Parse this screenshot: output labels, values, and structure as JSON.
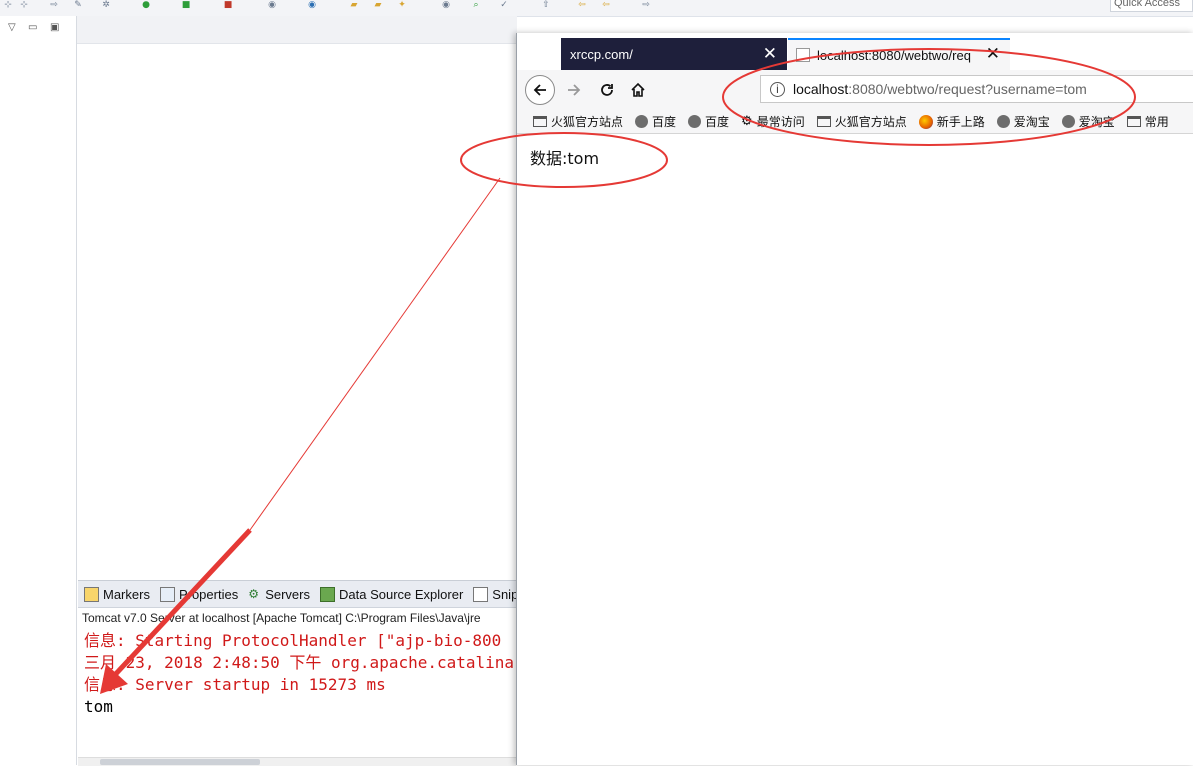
{
  "toolbar": {
    "quick_access": "Quick Access"
  },
  "console": {
    "tabs": [
      {
        "label": "Markers",
        "icon": "markers-icon"
      },
      {
        "label": "Properties",
        "icon": "properties-icon"
      },
      {
        "label": "Servers",
        "icon": "servers-icon"
      },
      {
        "label": "Data Source Explorer",
        "icon": "data-source-icon"
      },
      {
        "label": "Snip",
        "icon": "snippets-icon"
      }
    ],
    "status": "Tomcat v7.0 Server at localhost [Apache Tomcat] C:\\Program Files\\Java\\jre",
    "lines": [
      {
        "text": "信息: Starting ProtocolHandler [\"ajp-bio-800",
        "color": "#d01919"
      },
      {
        "text": "三月 23, 2018 2:48:50 下午 org.apache.catalina",
        "color": "#d01919"
      },
      {
        "text": "信息: Server startup in 15273 ms",
        "color": "#d01919"
      },
      {
        "text": "tom",
        "color": "#000000"
      }
    ]
  },
  "browser": {
    "tabs": [
      {
        "title": "xrccp.com/",
        "close": "✕",
        "active": false
      },
      {
        "title": "localhost:8080/webtwo/req",
        "close": "✕",
        "active": true
      }
    ],
    "url_host": "localhost",
    "url_rest": ":8080/webtwo/request?username=tom",
    "bookmarks": [
      {
        "label": "火狐官方站点",
        "icon": "folder-icon"
      },
      {
        "label": "百度",
        "icon": "globe-icon"
      },
      {
        "label": "百度",
        "icon": "globe-icon"
      },
      {
        "label": "最常访问",
        "icon": "gear-icon"
      },
      {
        "label": "火狐官方站点",
        "icon": "folder-icon"
      },
      {
        "label": "新手上路",
        "icon": "firefox-icon"
      },
      {
        "label": "爱淘宝",
        "icon": "globe-icon"
      },
      {
        "label": "爱淘宝",
        "icon": "globe-icon"
      },
      {
        "label": "常用",
        "icon": "folder-icon"
      }
    ],
    "page_text": "数据:tom"
  },
  "colors": {
    "annotation_red": "#e53935",
    "tab_active_accent": "#0a84ff",
    "tab_inactive_bg": "#1e1f3b",
    "console_error": "#d01919"
  }
}
